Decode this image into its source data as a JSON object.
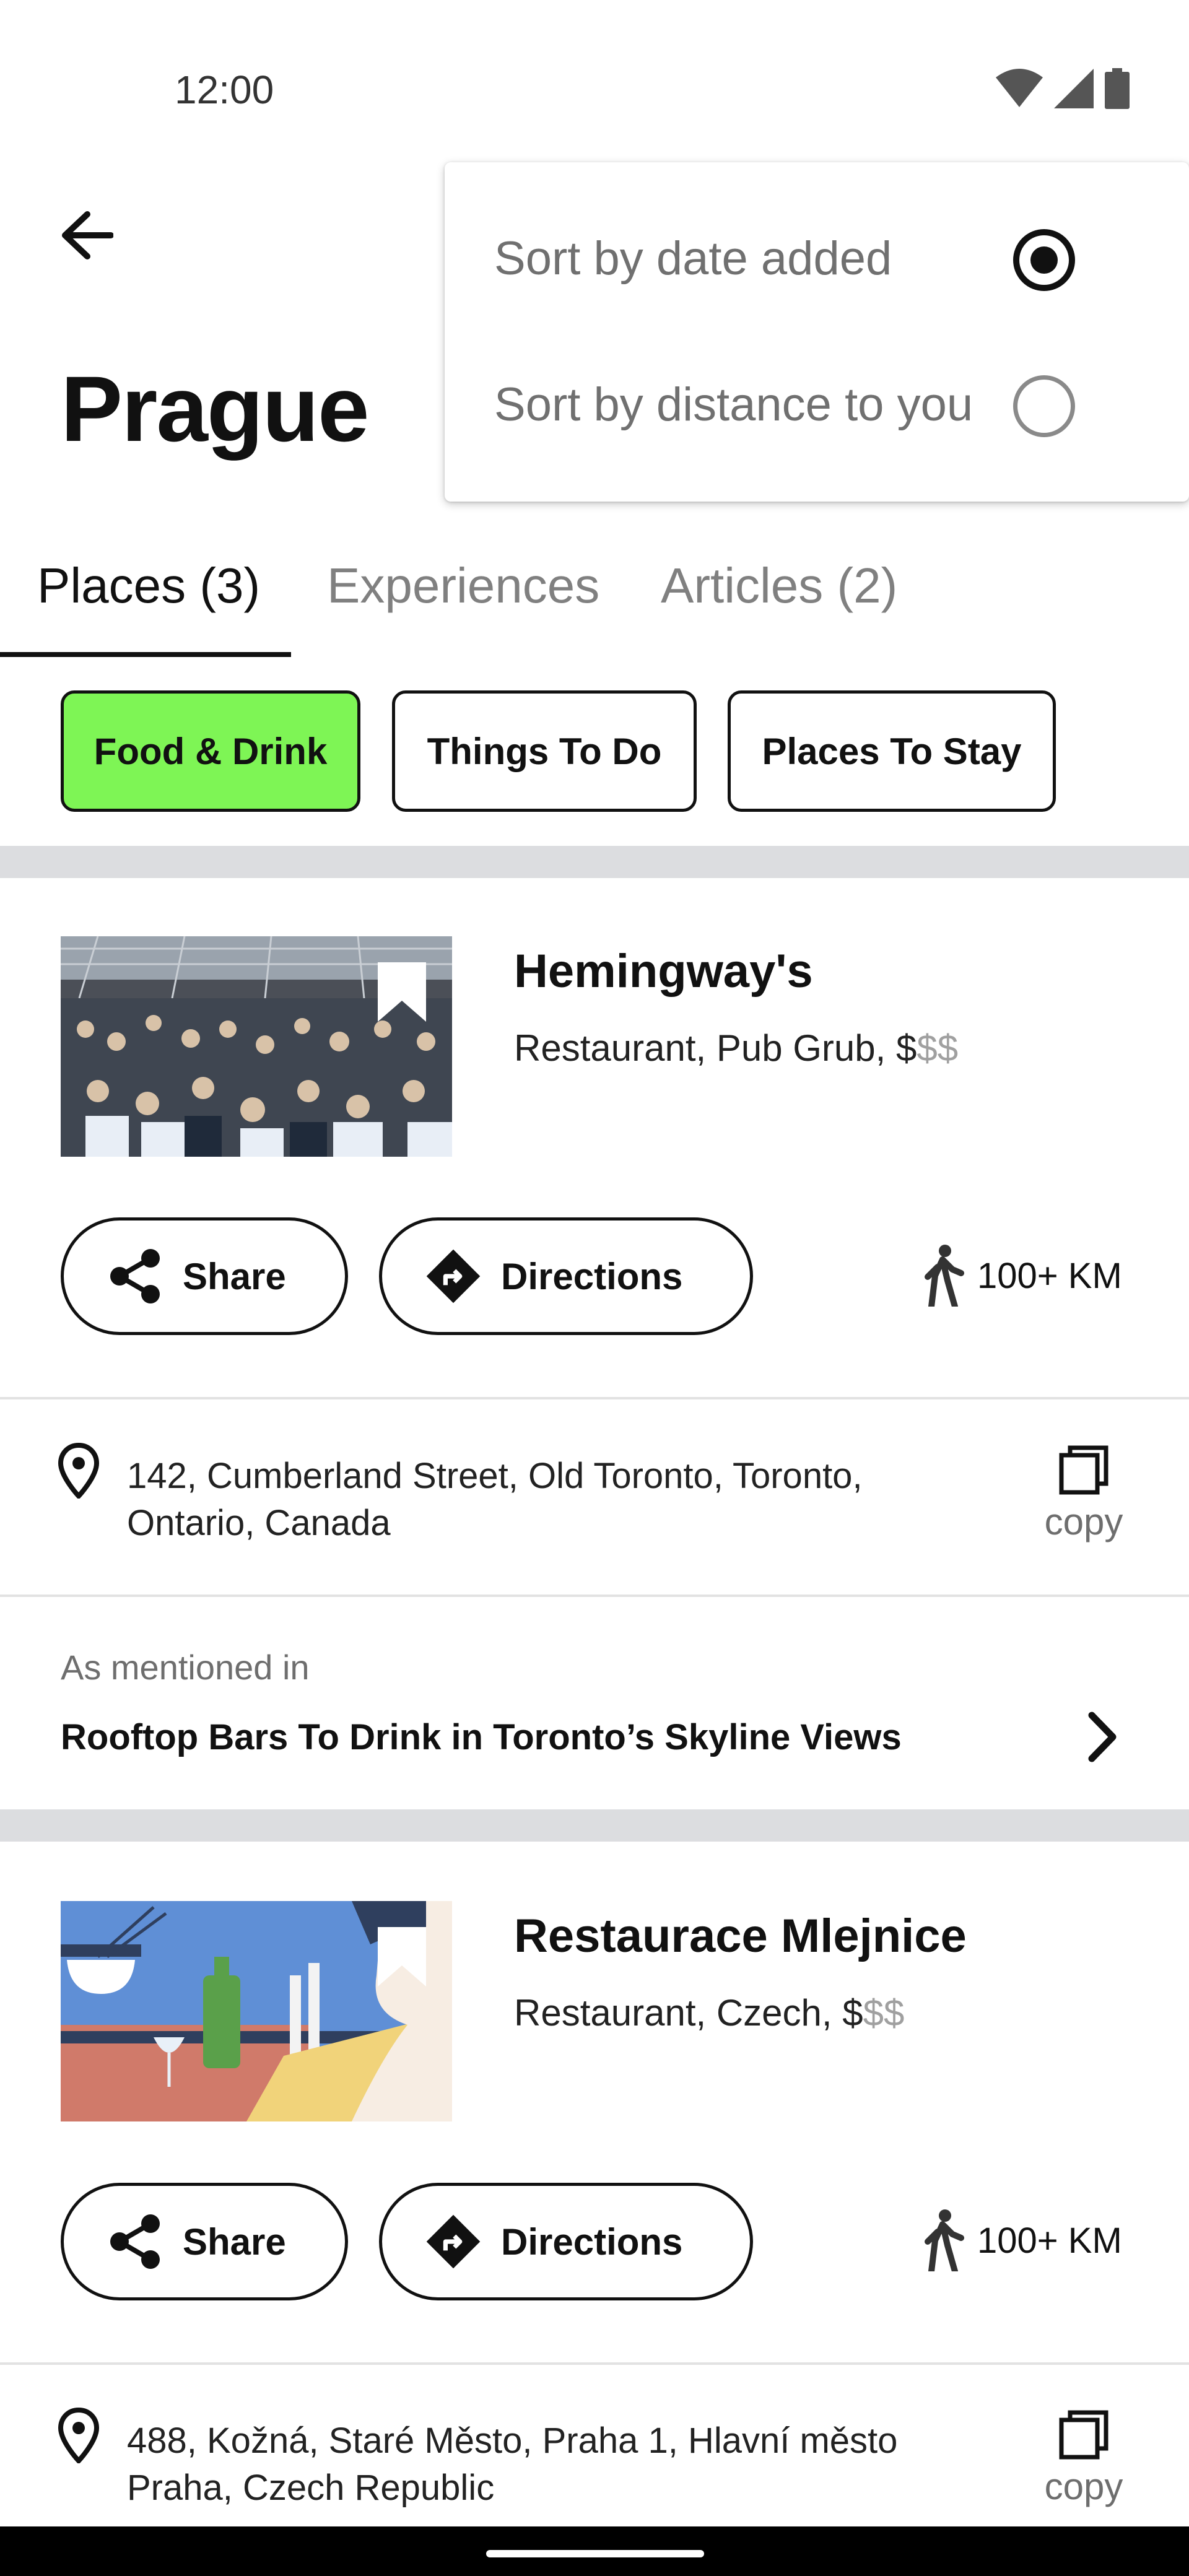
{
  "status_bar": {
    "time": "12:00",
    "icons": [
      "wifi-icon",
      "signal-icon",
      "battery-icon"
    ]
  },
  "header": {
    "back_icon": "arrow-left-icon",
    "title": "Prague"
  },
  "sort_menu": {
    "options": [
      {
        "label": "Sort by date added",
        "selected": true
      },
      {
        "label": "Sort by distance to you",
        "selected": false
      }
    ]
  },
  "tabs": [
    {
      "label": "Places (3)",
      "active": true
    },
    {
      "label": "Experiences",
      "active": false
    },
    {
      "label": "Articles (2)",
      "active": false
    }
  ],
  "filters": [
    {
      "label": "Food & Drink",
      "active": true
    },
    {
      "label": "Things To Do",
      "active": false
    },
    {
      "label": "Places To Stay",
      "active": false
    }
  ],
  "colors": {
    "active_chip": "#7ef555",
    "divider": "#dcdde0",
    "muted_text": "#a0a0a0"
  },
  "places": [
    {
      "name": "Hemingway's",
      "meta": "Restaurant, Pub Grub, $",
      "meta_dim": "$$",
      "share_label": "Share",
      "directions_label": "Directions",
      "distance": "100+ KM",
      "address_line1": "142, Cumberland Street, Old Toronto, Toronto,",
      "address_line2": "Ontario, Canada",
      "copy_label": "copy",
      "mentioned_label": "As mentioned in",
      "mentioned_title": "Rooftop Bars To Drink in Toronto’s Skyline Views"
    },
    {
      "name": "Restaurace Mlejnice",
      "meta": "Restaurant, Czech, $",
      "meta_dim": "$$",
      "share_label": "Share",
      "directions_label": "Directions",
      "distance": "100+ KM",
      "address_line1": "488, Kožná, Staré Město, Praha 1, Hlavní město",
      "address_line2": "Praha, Czech Republic",
      "copy_label": "copy"
    }
  ]
}
